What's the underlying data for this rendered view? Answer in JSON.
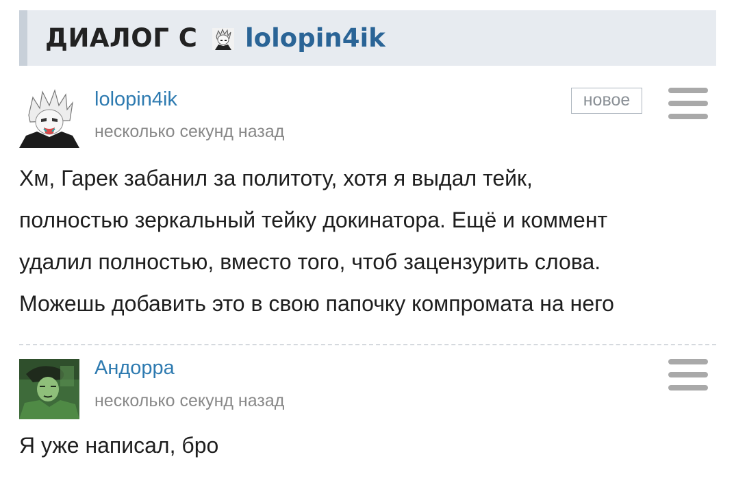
{
  "header": {
    "title": "ДИАЛОГ С",
    "username": "lolopin4ik"
  },
  "messages": [
    {
      "author": "lolopin4ik",
      "time": "несколько секунд назад",
      "badge": "новое",
      "lines": [
        "Хм, Гарек забанил за политоту, хотя я выдал тейк,",
        "полностью зеркальный тейку докинатора. Ещё и коммент",
        "удалил полностью, вместо того, чтоб зацензурить слова.",
        "Можешь добавить это в свою папочку компромата на него"
      ]
    },
    {
      "author": "Андорра",
      "time": "несколько секунд назад",
      "lines": [
        "Я уже написал, бро"
      ]
    }
  ],
  "icons": {
    "menu": "hamburger-menu-icon"
  }
}
